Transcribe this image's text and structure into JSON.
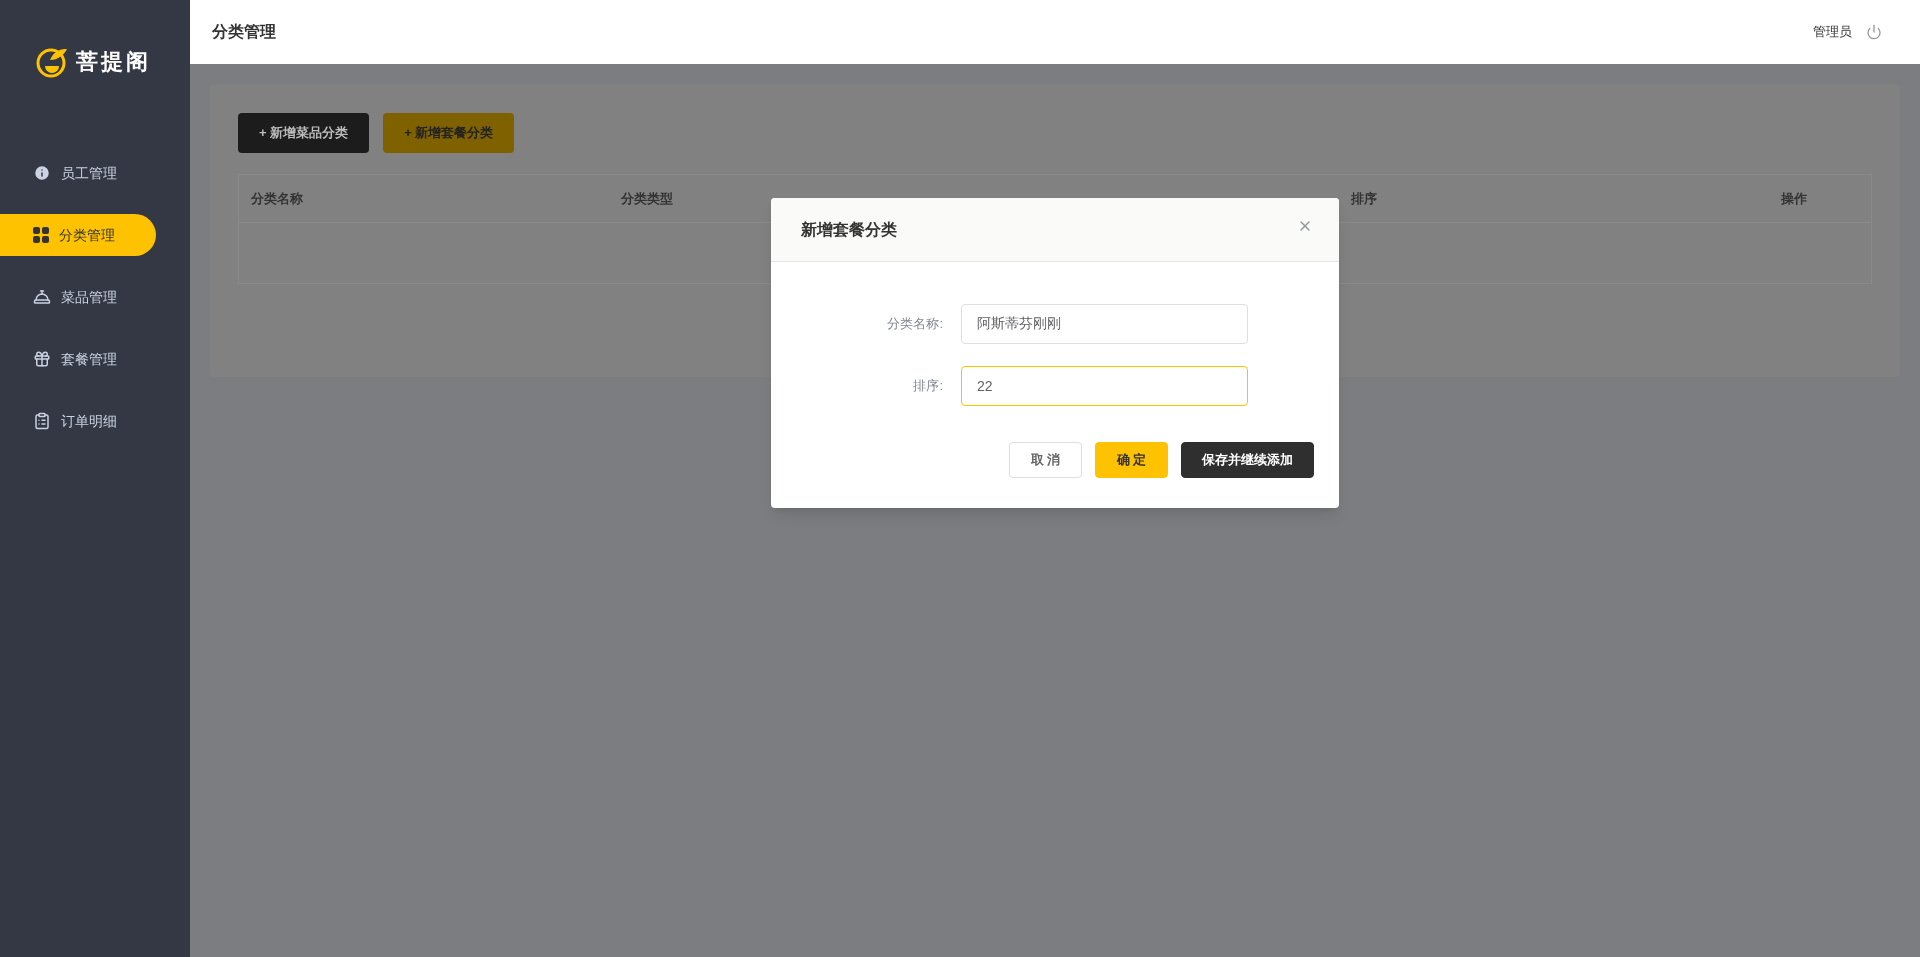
{
  "logo": {
    "text": "菩提阁"
  },
  "sidebar": {
    "items": [
      {
        "label": "员工管理",
        "kind": "staff",
        "selected": false
      },
      {
        "label": "分类管理",
        "kind": "category",
        "selected": true
      },
      {
        "label": "菜品管理",
        "kind": "dish",
        "selected": false
      },
      {
        "label": "套餐管理",
        "kind": "setmeal",
        "selected": false
      },
      {
        "label": "订单明细",
        "kind": "order",
        "selected": false
      }
    ]
  },
  "header": {
    "title": "分类管理",
    "user": "管理员"
  },
  "toolbar": {
    "buttons": [
      {
        "label": "+ 新增菜品分类",
        "kind": "dark"
      },
      {
        "label": "+ 新增套餐分类",
        "kind": "primary"
      }
    ]
  },
  "table": {
    "columns": [
      "分类名称",
      "分类类型",
      "排序",
      "操作"
    ]
  },
  "dialog": {
    "title": "新增套餐分类",
    "fields": [
      {
        "label": "分类名称:",
        "value": "阿斯蒂芬刚刚",
        "focused": false
      },
      {
        "label": "排序:",
        "value": "22",
        "focused": true
      }
    ],
    "buttons": [
      {
        "label": "取 消",
        "kind": "default"
      },
      {
        "label": "确 定",
        "kind": "primary"
      },
      {
        "label": "保存并继续添加",
        "kind": "dark"
      }
    ]
  }
}
